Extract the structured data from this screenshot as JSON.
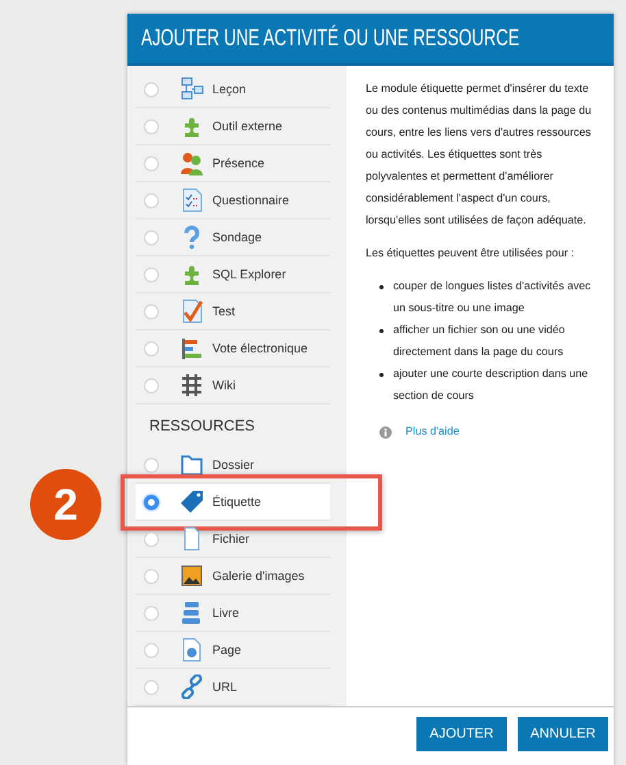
{
  "dialog": {
    "title": "AJOUTER UNE ACTIVITÉ OU UNE RESSOURCE"
  },
  "activities": [
    {
      "label": "Leçon",
      "selected": false,
      "highlighted": false
    },
    {
      "label": "Outil externe",
      "selected": false,
      "highlighted": false
    },
    {
      "label": "Présence",
      "selected": false,
      "highlighted": false
    },
    {
      "label": "Questionnaire",
      "selected": false,
      "highlighted": false
    },
    {
      "label": "Sondage",
      "selected": false,
      "highlighted": false
    },
    {
      "label": "SQL Explorer",
      "selected": false,
      "highlighted": false
    },
    {
      "label": "Test",
      "selected": false,
      "highlighted": false
    },
    {
      "label": "Vote électronique",
      "selected": false,
      "highlighted": false
    },
    {
      "label": "Wiki",
      "selected": false,
      "highlighted": false
    }
  ],
  "resources_heading": "RESSOURCES",
  "resources": [
    {
      "label": "Dossier",
      "selected": false,
      "highlighted": false
    },
    {
      "label": "Étiquette",
      "selected": true,
      "highlighted": true
    },
    {
      "label": "Fichier",
      "selected": false,
      "highlighted": false
    },
    {
      "label": "Galerie d'images",
      "selected": false,
      "highlighted": false
    },
    {
      "label": "Livre",
      "selected": false,
      "highlighted": false
    },
    {
      "label": "Page",
      "selected": false,
      "highlighted": false
    },
    {
      "label": "URL",
      "selected": false,
      "highlighted": false
    }
  ],
  "description": {
    "paragraphs": [
      "Le module étiquette permet d'insérer du texte ou des contenus multimédias dans la page du cours, entre les liens vers d'autres ressources ou activités. Les étiquettes sont très polyvalentes et permettent d'améliorer considérablement l'aspect d'un cours, lorsqu'elles sont utilisées de façon adéquate.",
      "Les étiquettes peuvent être utilisées pour :"
    ],
    "bullets": [
      "couper de longues listes d'activités avec un sous-titre ou une image",
      "afficher un fichier son ou une vidéo directement dans la page du cours",
      "ajouter une courte description dans une section de cours"
    ],
    "help_link": "Plus d'aide"
  },
  "buttons": [
    {
      "label": "AJOUTER"
    },
    {
      "label": "ANNULER"
    }
  ],
  "step_badge": "2"
}
